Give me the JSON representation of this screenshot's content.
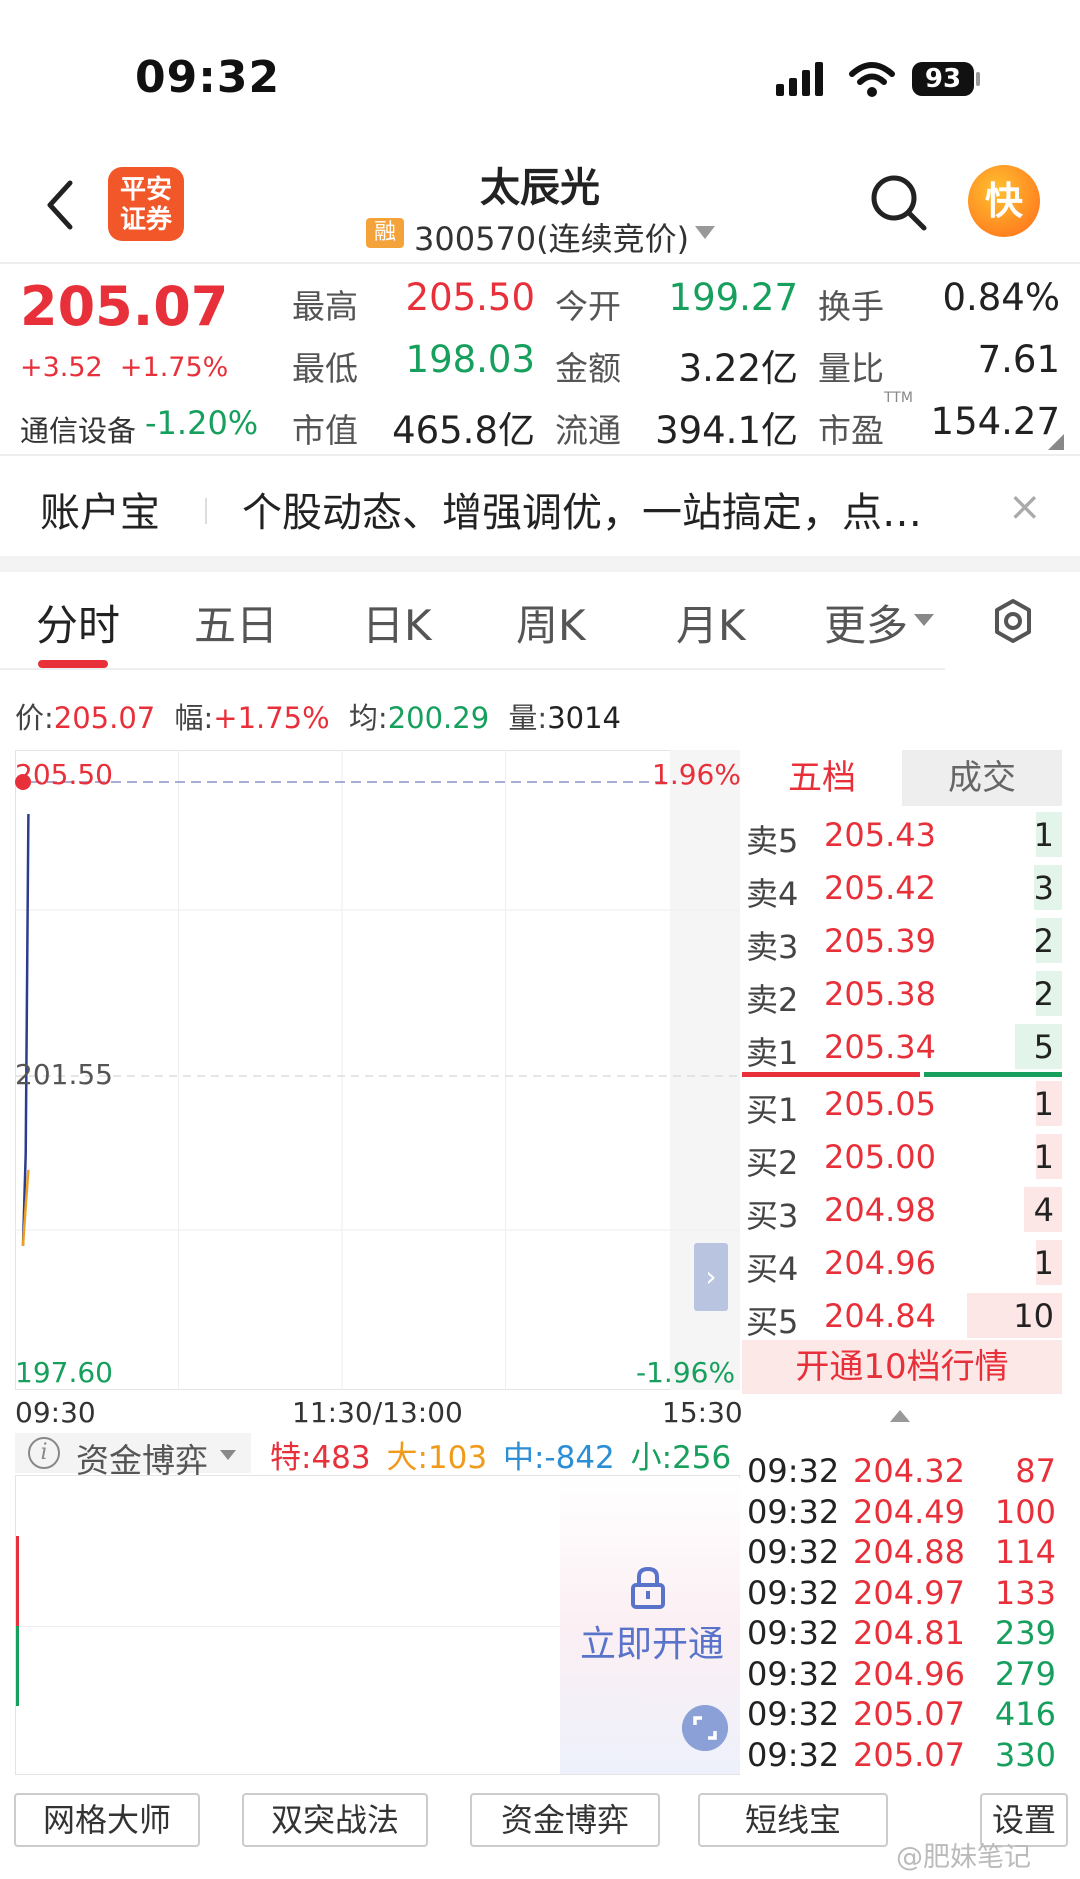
{
  "status_bar": {
    "time": "09:32",
    "battery": "93"
  },
  "header": {
    "logo_line1": "平安",
    "logo_line2": "证券",
    "stock_name": "太辰光",
    "rong_badge": "融",
    "stock_code": "300570(连续竞价)",
    "kuai_label": "快"
  },
  "quote": {
    "price": "205.07",
    "change": "+3.52  +1.75%",
    "sector_name": "通信设备",
    "sector_change": "-1.20%",
    "high_label": "最高",
    "high": "205.50",
    "low_label": "最低",
    "low": "198.03",
    "mcap_label": "市值",
    "mcap": "465.8亿",
    "open_label": "今开",
    "open": "199.27",
    "amount_label": "金额",
    "amount": "3.22亿",
    "float_label": "流通",
    "float": "394.1亿",
    "turnover_label": "换手",
    "turnover": "0.84%",
    "vol_ratio_label": "量比",
    "vol_ratio": "7.61",
    "pe_label": "市盈",
    "pe_suffix": "TTM",
    "pe": "154.27"
  },
  "banner": {
    "title": "账户宝",
    "text": "个股动态、增强调优，一站搞定，点…",
    "close": "×"
  },
  "tabs": [
    "分时",
    "五日",
    "日K",
    "周K",
    "月K",
    "更多"
  ],
  "info_line": {
    "price_label": "价:",
    "price": "205.07",
    "amp_label": "幅:",
    "amp": "+1.75%",
    "avg_label": "均:",
    "avg": "200.29",
    "vol_label": "量:",
    "vol": "3014"
  },
  "chart": {
    "y_top": "205.50",
    "y_mid": "201.55",
    "y_bottom": "197.60",
    "pct_top": "1.96%",
    "pct_bottom": "-1.96%",
    "expand": "›",
    "t_start": "09:30",
    "t_mid": "11:30/13:00",
    "t_end": "15:30"
  },
  "chart_data": {
    "type": "line",
    "title": "",
    "xlabel": "",
    "ylabel": "",
    "x": [
      "09:30",
      "09:31",
      "09:32"
    ],
    "series": [
      {
        "values": [
          199.27,
          200.5,
          205.07
        ]
      },
      {
        "values": [
          199.27,
          199.8,
          200.29
        ]
      }
    ],
    "ylim": [
      197.6,
      205.5
    ],
    "xlim": [
      "09:30",
      "15:30"
    ],
    "prev_close": 201.55,
    "grid": true
  },
  "order_book": {
    "tab_left": "五档",
    "tab_right": "成交",
    "asks": [
      {
        "label": "卖5",
        "price": "205.43",
        "vol": "1",
        "vol_n": 1
      },
      {
        "label": "卖4",
        "price": "205.42",
        "vol": "3",
        "vol_n": 3
      },
      {
        "label": "卖3",
        "price": "205.39",
        "vol": "2",
        "vol_n": 2
      },
      {
        "label": "卖2",
        "price": "205.38",
        "vol": "2",
        "vol_n": 2
      },
      {
        "label": "卖1",
        "price": "205.34",
        "vol": "5",
        "vol_n": 5
      }
    ],
    "bids": [
      {
        "label": "买1",
        "price": "205.05",
        "vol": "1",
        "vol_n": 1
      },
      {
        "label": "买2",
        "price": "205.00",
        "vol": "1",
        "vol_n": 1
      },
      {
        "label": "买3",
        "price": "204.98",
        "vol": "4",
        "vol_n": 4
      },
      {
        "label": "买4",
        "price": "204.96",
        "vol": "1",
        "vol_n": 1
      },
      {
        "label": "买5",
        "price": "204.84",
        "vol": "10",
        "vol_n": 10
      }
    ],
    "open10": "开通10档行情"
  },
  "trades": [
    {
      "time": "09:32",
      "price": "204.32",
      "vol": "87",
      "side": "buy"
    },
    {
      "time": "09:32",
      "price": "204.49",
      "vol": "100",
      "side": "buy"
    },
    {
      "time": "09:32",
      "price": "204.88",
      "vol": "114",
      "side": "buy"
    },
    {
      "time": "09:32",
      "price": "204.97",
      "vol": "133",
      "side": "buy"
    },
    {
      "time": "09:32",
      "price": "204.81",
      "vol": "239",
      "side": "sell"
    },
    {
      "time": "09:32",
      "price": "204.96",
      "vol": "279",
      "side": "sell"
    },
    {
      "time": "09:32",
      "price": "205.07",
      "vol": "416",
      "side": "sell"
    },
    {
      "time": "09:32",
      "price": "205.07",
      "vol": "330",
      "side": "sell"
    }
  ],
  "capital": {
    "label": "资金博弈",
    "te": "特:483",
    "da": "大:103",
    "zhong": "中:-842",
    "xiao": "小:256",
    "unlock": "立即开通"
  },
  "toolbar": [
    "网格大师",
    "双突战法",
    "资金博弈",
    "短线宝",
    "设置"
  ],
  "watermark": "@肥妹笔记",
  "colors": {
    "up": "#e8303a",
    "down": "#17a05d",
    "accent": "#5873c9"
  }
}
